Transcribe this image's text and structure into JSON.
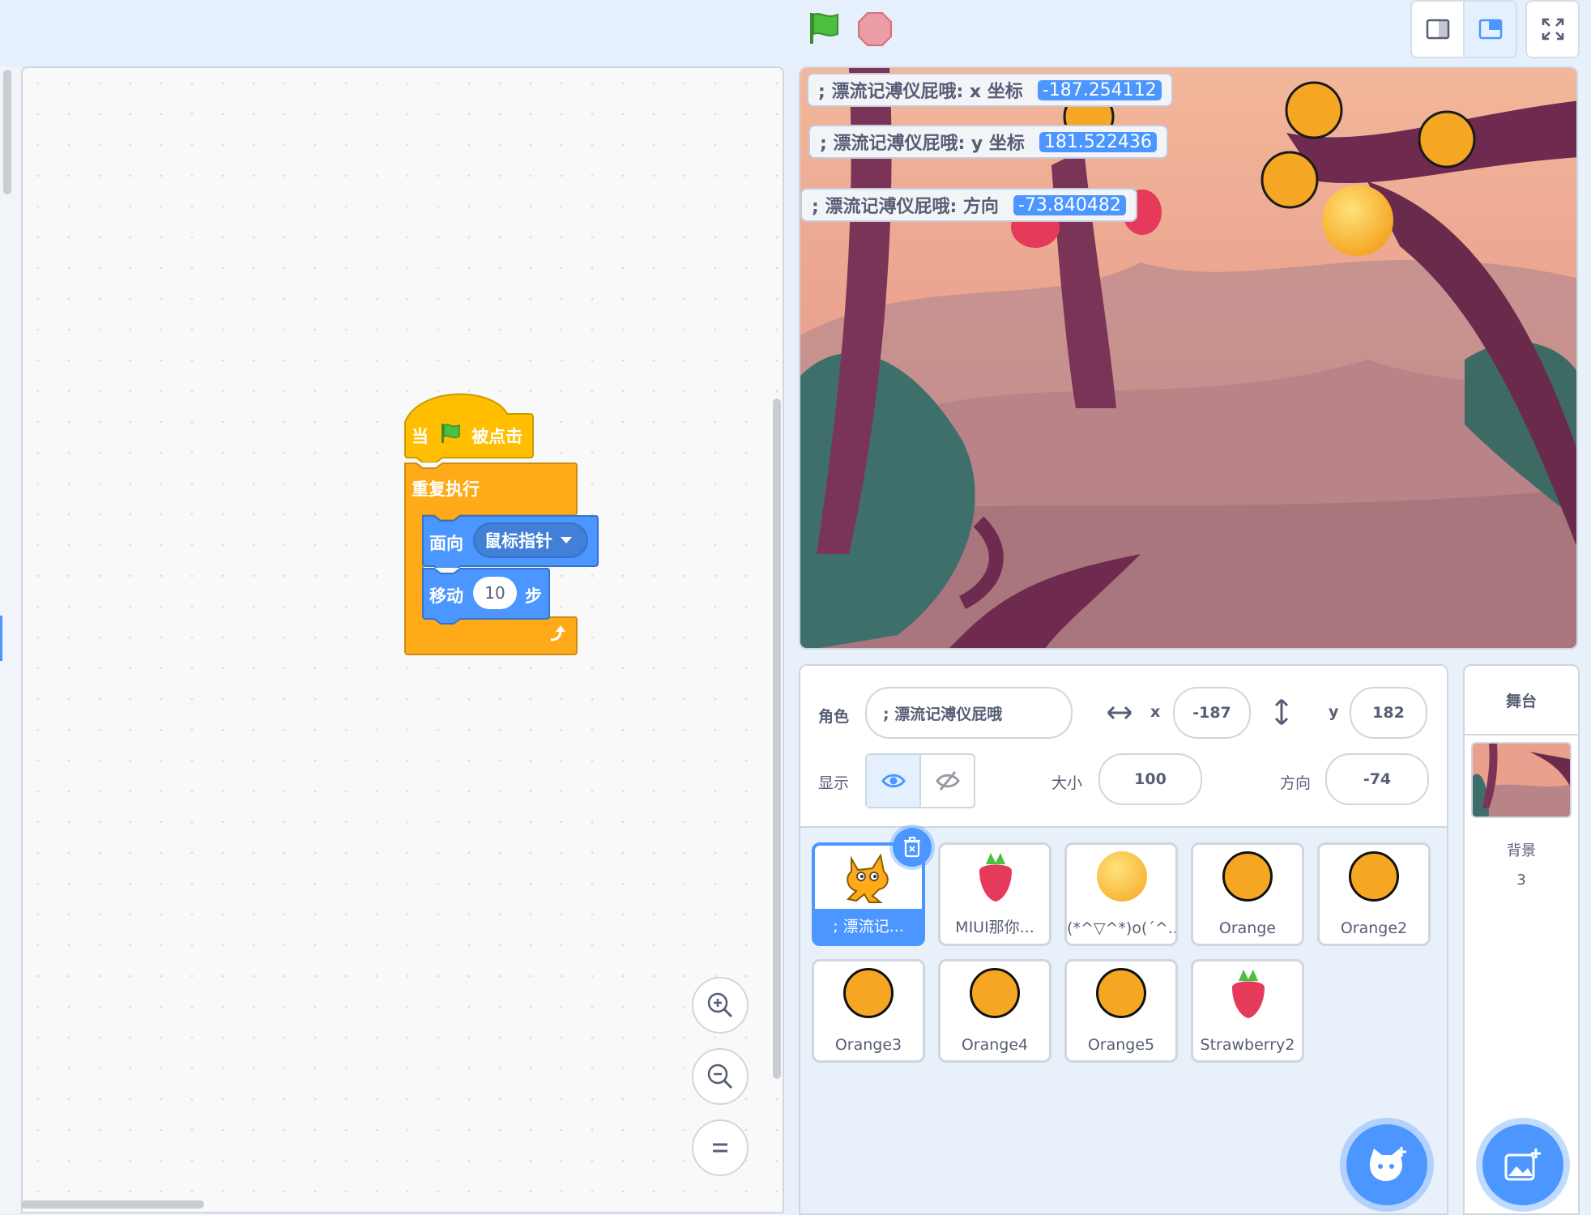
{
  "controls": {
    "green_flag": "green-flag-icon",
    "stop": "stop-icon",
    "layout_small": "small-stage-icon",
    "layout_normal": "normal-stage-icon",
    "fullscreen": "fullscreen-icon"
  },
  "script": {
    "hat_when": "当",
    "hat_clicked": "被点击",
    "forever": "重复执行",
    "point_towards": "面向",
    "point_target": "鼠标指针",
    "move": "移动",
    "move_steps": "10",
    "move_unit": "步"
  },
  "monitors": [
    {
      "label": "; 漂流记溥仪屁哦: x 坐标",
      "value": "-187.254112"
    },
    {
      "label": "; 漂流记溥仪屁哦: y 坐标",
      "value": "181.522436"
    },
    {
      "label": "; 漂流记溥仪屁哦: 方向",
      "value": "-73.840482"
    }
  ],
  "sprite_info": {
    "sprite_label": "角色",
    "sprite_name": "; 漂流记溥仪屁哦",
    "x_label": "x",
    "x_value": "-187",
    "y_label": "y",
    "y_value": "182",
    "show_label": "显示",
    "size_label": "大小",
    "size_value": "100",
    "direction_label": "方向",
    "direction_value": "-74"
  },
  "sprites": [
    {
      "name": "; 漂流记...",
      "icon": "cat",
      "selected": true
    },
    {
      "name": "MIUI那你...",
      "icon": "strawberry"
    },
    {
      "name": "(*^▽^*)o(´^...",
      "icon": "ball"
    },
    {
      "name": "Orange",
      "icon": "orange"
    },
    {
      "name": "Orange2",
      "icon": "orange"
    },
    {
      "name": "Orange3",
      "icon": "orange"
    },
    {
      "name": "Orange4",
      "icon": "orange"
    },
    {
      "name": "Orange5",
      "icon": "orange"
    },
    {
      "name": "Strawberry2",
      "icon": "strawberry"
    }
  ],
  "stage_pane": {
    "title": "舞台",
    "backdrops_label": "背景",
    "backdrops_count": "3"
  }
}
